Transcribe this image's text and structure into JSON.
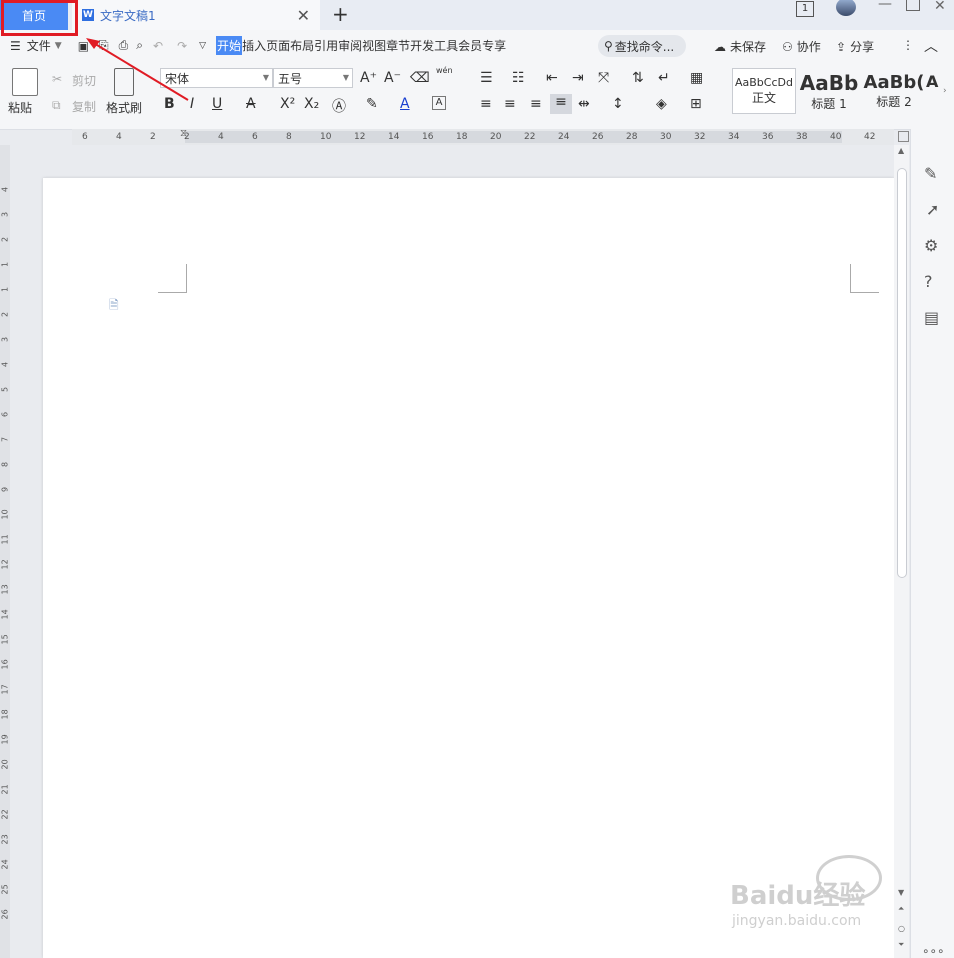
{
  "titlebar": {
    "home_tab": "首页",
    "doc_tab": "文字文稿1",
    "doc_icon_letter": "W",
    "add_tab": "+",
    "page_count_badge": "1"
  },
  "menubar": {
    "file_menu": "文件",
    "items": [
      "开始",
      "插入",
      "页面布局",
      "引用",
      "审阅",
      "视图",
      "章节",
      "开发工具",
      "会员专享"
    ],
    "active_index": 0,
    "search_placeholder": "查找命令...",
    "unsaved": "未保存",
    "collaborate": "协作",
    "share": "分享"
  },
  "ribbon": {
    "paste": "粘贴",
    "cut": "剪切",
    "copy": "复制",
    "format_painter": "格式刷",
    "font_name": "宋体",
    "font_size": "五号",
    "pinyin_label": "wén",
    "styles": [
      {
        "preview": "AaBbCcDd",
        "label": "正文"
      },
      {
        "preview": "AaBb",
        "label": "标题 1"
      },
      {
        "preview": "AaBb(",
        "label": "标题 2"
      },
      {
        "preview": "A",
        "label": ""
      }
    ]
  },
  "ruler": {
    "h_ticks": [
      "6",
      "4",
      "2",
      "2",
      "4",
      "6",
      "8",
      "10",
      "12",
      "14",
      "16",
      "18",
      "20",
      "22",
      "24",
      "26",
      "28",
      "30",
      "32",
      "34",
      "36",
      "38",
      "40",
      "42"
    ],
    "v_ticks": [
      "4",
      "3",
      "2",
      "1",
      "1",
      "2",
      "3",
      "4",
      "5",
      "6",
      "7",
      "8",
      "9",
      "10",
      "11",
      "12",
      "13",
      "14",
      "15",
      "16",
      "17",
      "18",
      "19",
      "20",
      "21",
      "22",
      "23",
      "24",
      "25",
      "26"
    ]
  },
  "watermark": {
    "brand": "Baidu经验",
    "url": "jingyan.baidu.com"
  },
  "colors": {
    "accent": "#4a8af4",
    "annotation": "#e01b24"
  }
}
